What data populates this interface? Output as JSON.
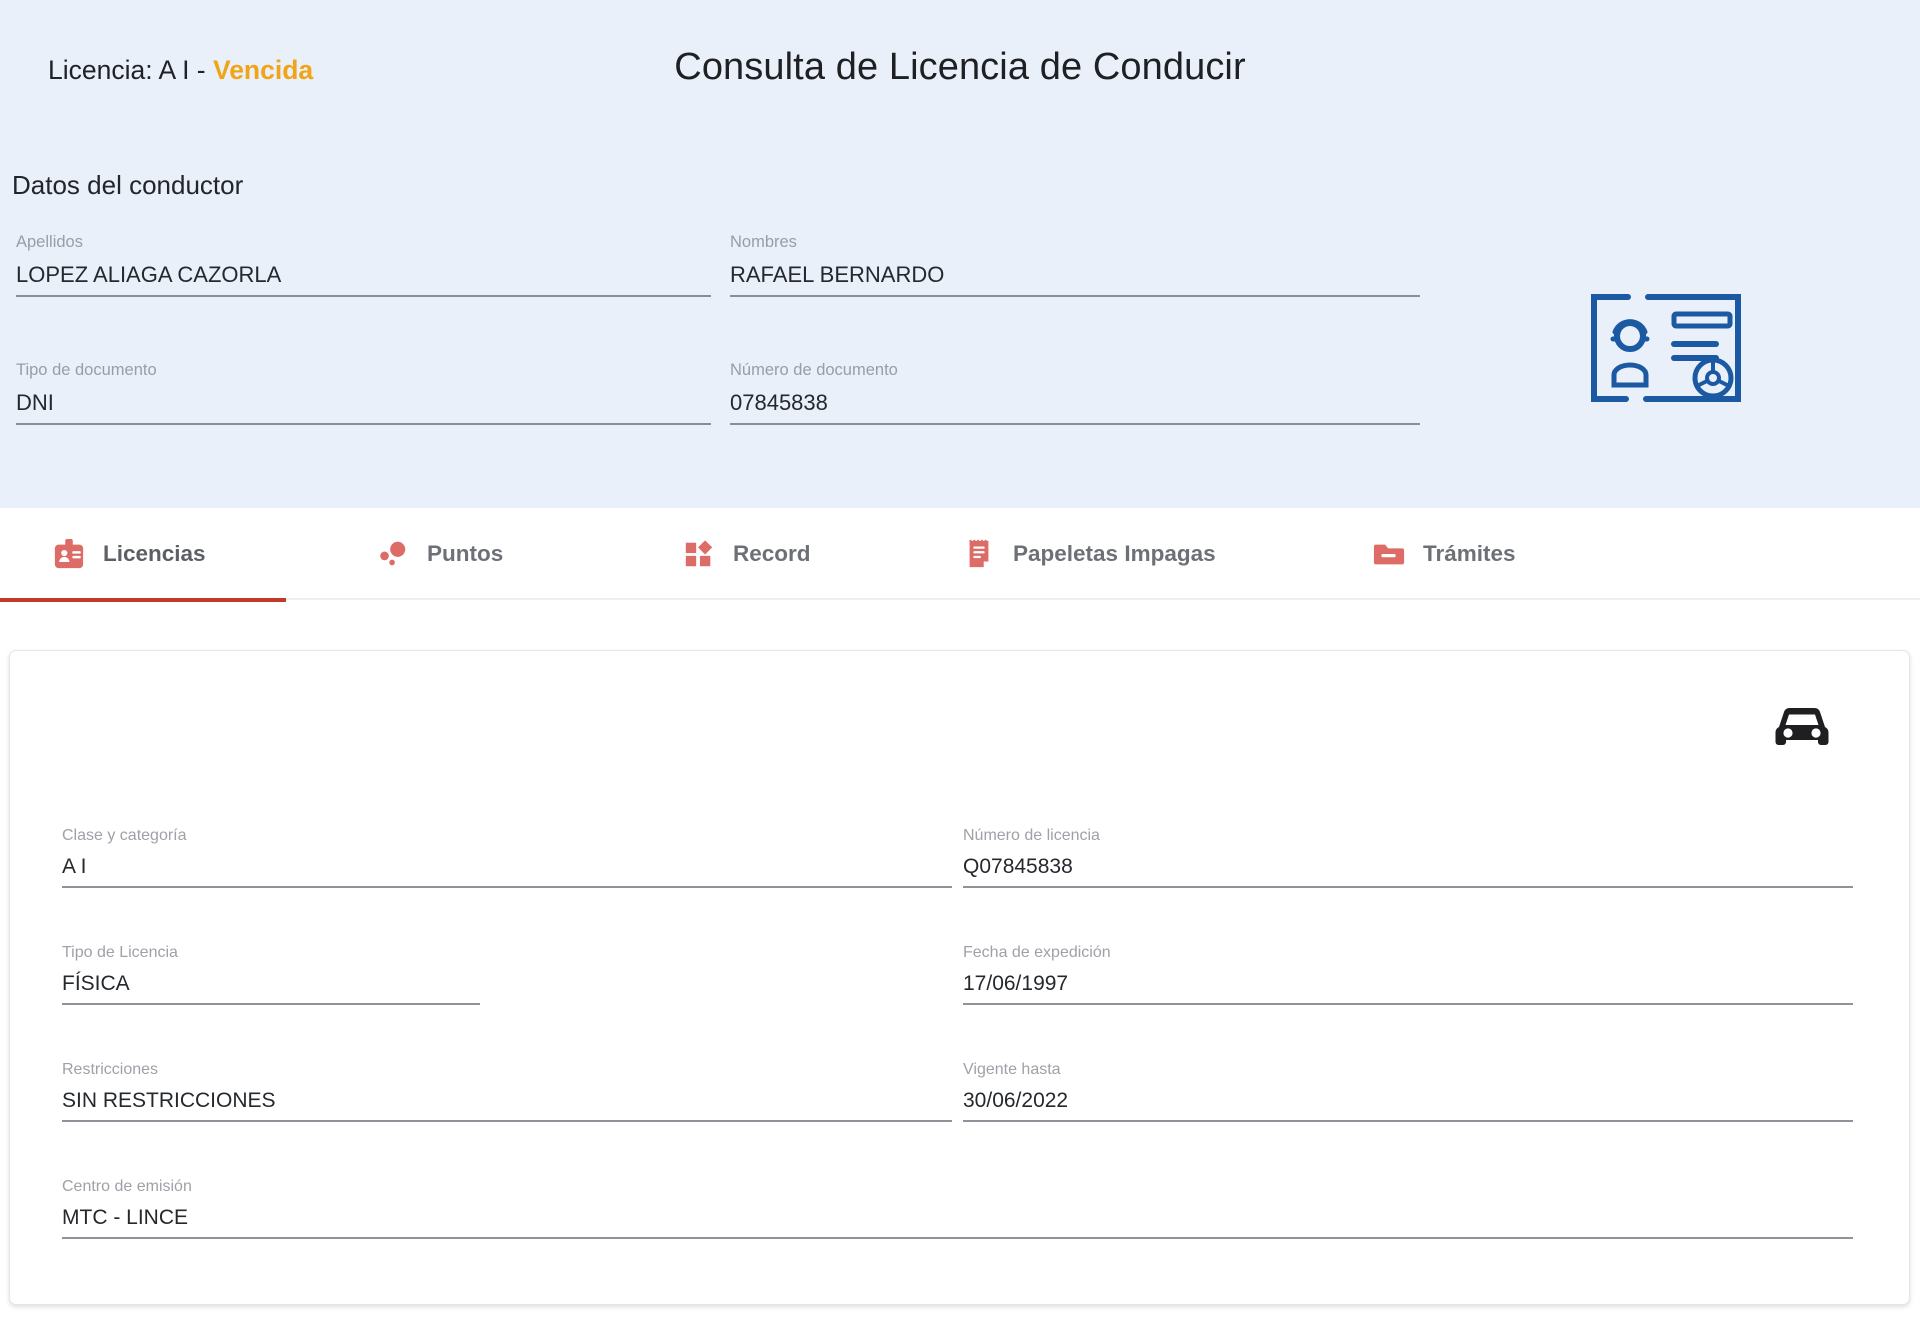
{
  "header": {
    "title": "Consulta de Licencia de Conducir",
    "section_heading": "Datos del conductor",
    "card_icon_name": "driver-license-card-icon",
    "fields": {
      "apellidos": {
        "label": "Apellidos",
        "value": "LOPEZ ALIAGA CAZORLA"
      },
      "nombres": {
        "label": "Nombres",
        "value": "RAFAEL BERNARDO"
      },
      "tipo_doc": {
        "label": "Tipo de documento",
        "value": "DNI"
      },
      "numero_doc": {
        "label": "Número de documento",
        "value": "07845838"
      }
    }
  },
  "tabs": [
    {
      "label": "Licencias",
      "icon": "id-badge-icon",
      "active": true
    },
    {
      "label": "Puntos",
      "icon": "dots-icon",
      "active": false
    },
    {
      "label": "Record",
      "icon": "grid-diamond-icon",
      "active": false
    },
    {
      "label": "Papeletas Impagas",
      "icon": "receipt-icon",
      "active": false
    },
    {
      "label": "Trámites",
      "icon": "folder-icon",
      "active": false
    }
  ],
  "license_card": {
    "title_prefix": "Licencia: A I - ",
    "status": "Vencida",
    "vehicle_icon_name": "car-front-icon",
    "fields": {
      "clase": {
        "label": "Clase y categoría",
        "value": "A I"
      },
      "numero": {
        "label": "Número de licencia",
        "value": "Q07845838"
      },
      "tipo": {
        "label": "Tipo de Licencia",
        "value": "FÍSICA"
      },
      "expedicion": {
        "label": "Fecha de expedición",
        "value": "17/06/1997"
      },
      "restricciones": {
        "label": "Restricciones",
        "value": "SIN RESTRICCIONES"
      },
      "vigente": {
        "label": "Vigente hasta",
        "value": "30/06/2022"
      },
      "centro": {
        "label": "Centro de emisión",
        "value": "MTC - LINCE"
      }
    }
  },
  "colors": {
    "header_bg": "#e9f0f9",
    "accent_red": "#c0392b",
    "tab_icon_red": "#dd6b66",
    "status_amber": "#f0a417",
    "icon_blue": "#1b5aa3",
    "label_gray": "#9a9da3",
    "value_dark": "#25282d"
  }
}
